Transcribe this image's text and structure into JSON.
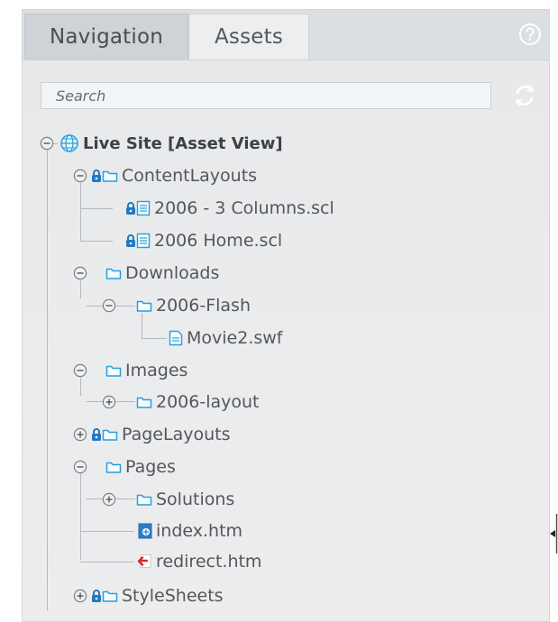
{
  "tabs": [
    {
      "label": "Navigation",
      "active": false
    },
    {
      "label": "Assets",
      "active": true
    }
  ],
  "search": {
    "placeholder": "Search"
  },
  "icons": {
    "help": "help-icon",
    "refresh": "refresh-icon"
  },
  "colors": {
    "folder": "#2a9fd8",
    "lock": "#1f79c4",
    "text": "#54575a",
    "redirect": "#d42a2a"
  },
  "tree": {
    "root": {
      "label": "Live Site [Asset View]",
      "icon": "globe-icon",
      "expanded": true
    },
    "items": [
      {
        "label": "ContentLayouts",
        "icon": "folder-icon",
        "locked": true,
        "expanded": true
      },
      {
        "label": "2006 - 3 Columns.scl",
        "icon": "layout-file-icon",
        "locked": true
      },
      {
        "label": "2006 Home.scl",
        "icon": "layout-file-icon",
        "locked": true
      },
      {
        "label": "Downloads",
        "icon": "folder-icon",
        "locked": false,
        "expanded": true
      },
      {
        "label": "2006-Flash",
        "icon": "folder-icon",
        "locked": false,
        "expanded": true
      },
      {
        "label": "Movie2.swf",
        "icon": "file-icon",
        "locked": false
      },
      {
        "label": "Images",
        "icon": "folder-icon",
        "locked": false,
        "expanded": true
      },
      {
        "label": "2006-layout",
        "icon": "folder-icon",
        "locked": false,
        "expanded": false
      },
      {
        "label": "PageLayouts",
        "icon": "folder-icon",
        "locked": true,
        "expanded": false
      },
      {
        "label": "Pages",
        "icon": "folder-icon",
        "locked": false,
        "expanded": true
      },
      {
        "label": "Solutions",
        "icon": "folder-icon",
        "locked": false,
        "expanded": false
      },
      {
        "label": "index.htm",
        "icon": "page-icon",
        "locked": false
      },
      {
        "label": "redirect.htm",
        "icon": "redirect-icon",
        "locked": false
      },
      {
        "label": "StyleSheets",
        "icon": "folder-icon",
        "locked": true,
        "expanded": false
      }
    ]
  }
}
